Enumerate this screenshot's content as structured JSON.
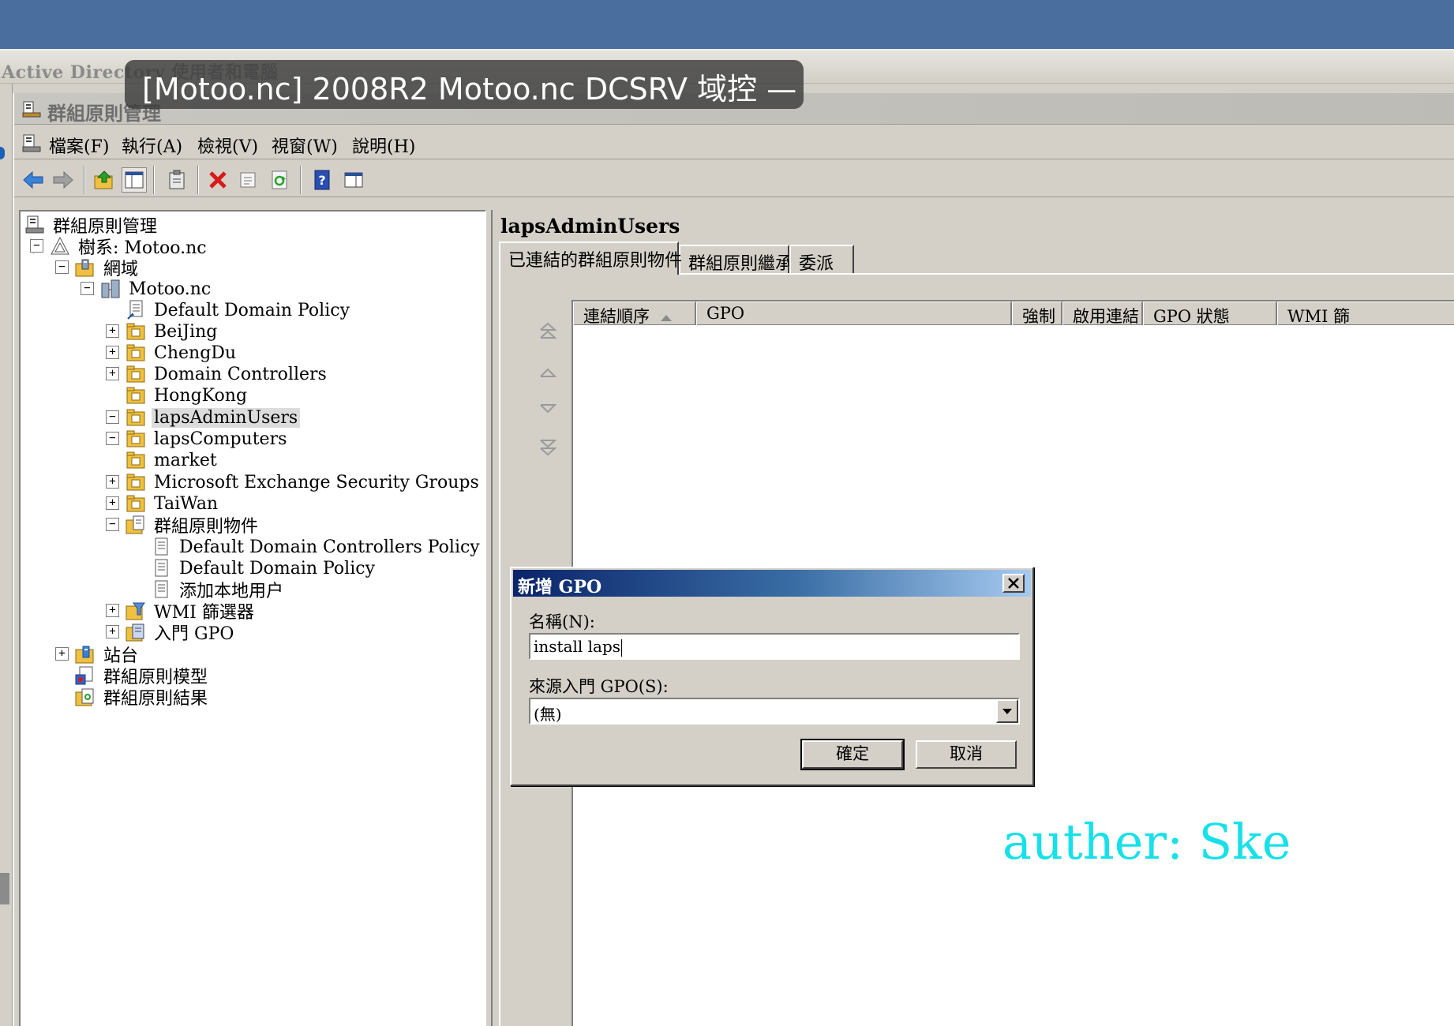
{
  "aduc": {
    "title": "Active Directory 使用者和電腦"
  },
  "gpmc": {
    "title": "群組原則管理",
    "menu": [
      "檔案(F)",
      "執行(A)",
      "檢視(V)",
      "視窗(W)",
      "說明(H)"
    ]
  },
  "overlay": {
    "window_title": "[Motoo.nc] 2008R2 Motoo.nc DCSRV 域控 —"
  },
  "tree": {
    "root": "群組原則管理",
    "forest": "樹系: Motoo.nc",
    "domains": "網域",
    "domain": "Motoo.nc",
    "default_domain_policy": "Default Domain Policy",
    "ous": [
      "BeiJing",
      "ChengDu",
      "Domain Controllers",
      "HongKong",
      "lapsAdminUsers",
      "lapsComputers",
      "market",
      "Microsoft Exchange Security Groups",
      "TaiWan"
    ],
    "gpo_container": "群組原則物件",
    "gpos": [
      "Default Domain Controllers Policy",
      "Default Domain Policy",
      "添加本地用户"
    ],
    "wmi_filters": "WMI 篩選器",
    "starter_gpo": "入門 GPO",
    "sites": "站台",
    "modeling": "群組原則模型",
    "results": "群組原則結果",
    "selected": "lapsAdminUsers"
  },
  "right": {
    "title": "lapsAdminUsers",
    "tabs": [
      "已連結的群組原則物件",
      "群組原則繼承",
      "委派"
    ],
    "active_tab": 0,
    "columns": [
      "連結順序",
      "GPO",
      "強制",
      "啟用連結",
      "GPO 狀態",
      "WMI 篩"
    ]
  },
  "dialog": {
    "title": "新增 GPO",
    "name_label": "名稱(N):",
    "name_value": "install laps",
    "source_label": "來源入門 GPO(S):",
    "source_value": "(無)",
    "ok_label": "確定",
    "cancel_label": "取消"
  },
  "watermark": "auther: Ske",
  "colors": {
    "desktop": "#4a6e9e",
    "dialog_title_start": "#0a246a",
    "dialog_title_end": "#a6caf0",
    "watermark": "#18e0e8"
  }
}
